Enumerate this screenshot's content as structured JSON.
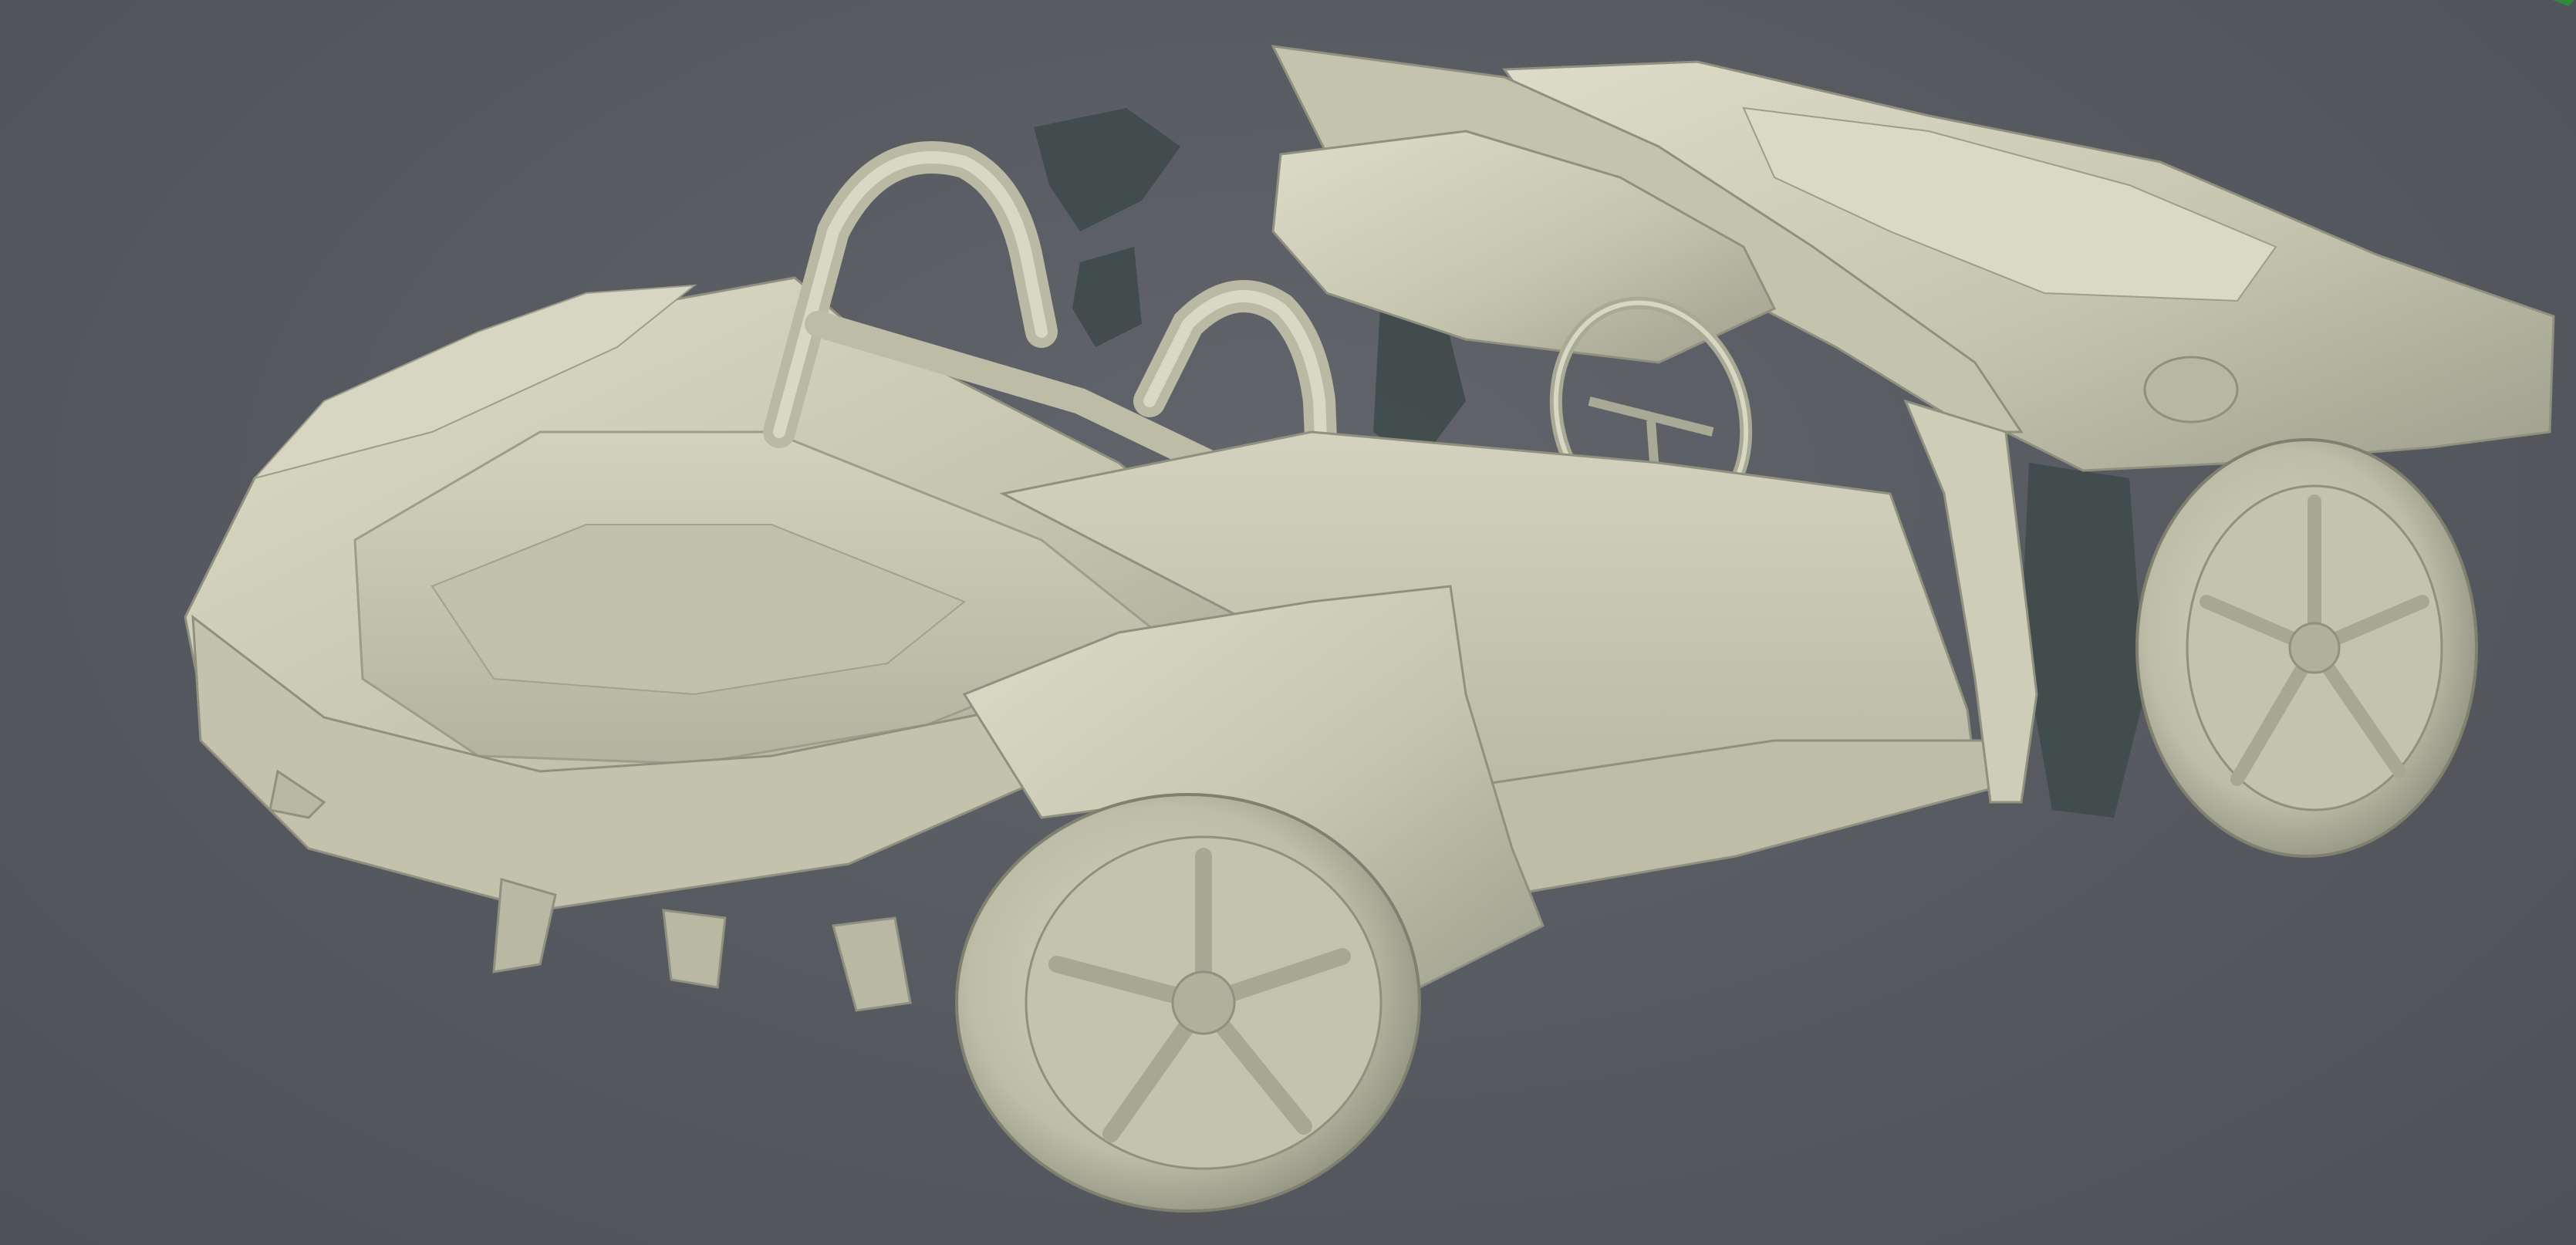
{
  "viewport": {
    "background": "#56595f",
    "model_color": "#c9c9b3",
    "model_shadow": "#8f9080",
    "model_highlight": "#e4e4d2",
    "hole_color": "#3e4848",
    "axis_color": "#2e8b3a"
  },
  "model": {
    "icon": "scanned-car-mesh"
  }
}
